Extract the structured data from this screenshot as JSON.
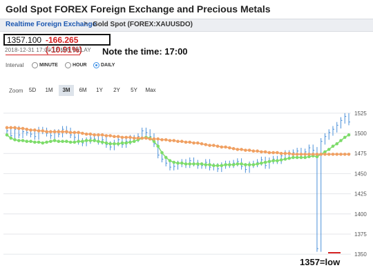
{
  "header": {
    "title": "Gold Spot FOREX Foreign Exchange and Precious Metals"
  },
  "breadcrumb": {
    "link": "Realtime Foreign Exchange",
    "separator": ">",
    "current": "Gold Spot (FOREX:XAUUSDO)"
  },
  "quote": {
    "price": "1357.100",
    "change": "-166.265 (-10.91%)",
    "timestamp": "2018-12-31 17:00:12",
    "delay": "MIN DELAY"
  },
  "annotations": {
    "time_note": "Note the time: 17:00",
    "low_note": "1357=low"
  },
  "interval": {
    "label": "Interval",
    "options": [
      "MINUTE",
      "HOUR",
      "DAILY"
    ],
    "selected": "DAILY"
  },
  "zoom": {
    "label": "Zoom",
    "options": [
      "5D",
      "1M",
      "3M",
      "6M",
      "1Y",
      "2Y",
      "5Y",
      "Max"
    ],
    "selected": "3M"
  },
  "colors": {
    "price_bars": "#4a90d9",
    "ma_short": "#7ddc6a",
    "ma_long": "#f0a062",
    "change_red": "#d42020",
    "link_blue": "#1a56b0"
  },
  "chart_data": {
    "type": "line",
    "ylim": [
      1345,
      1530
    ],
    "yticks": [
      "1525",
      "1500",
      "1475",
      "1450",
      "1425",
      "1400",
      "1375",
      "1350"
    ],
    "series": [
      {
        "values": [
          1503,
          1497,
          1505,
          1498,
          1502,
          1501,
          1499,
          1496,
          1504,
          1503,
          1500,
          1497,
          1501,
          1499,
          1505,
          1503,
          1498,
          1495,
          1490,
          1488,
          1491,
          1494,
          1493,
          1490,
          1492,
          1486,
          1483,
          1488,
          1492,
          1486,
          1490,
          1494,
          1493,
          1496,
          1503,
          1501,
          1496,
          1487,
          1473,
          1468,
          1463,
          1458,
          1459,
          1462,
          1464,
          1461,
          1466,
          1463,
          1460,
          1460,
          1464,
          1458,
          1459,
          1456,
          1460,
          1462,
          1461,
          1463,
          1465,
          1459,
          1455,
          1461,
          1462,
          1464,
          1467,
          1460,
          1466,
          1468,
          1466,
          1472,
          1475,
          1474,
          1476,
          1478,
          1474,
          1477,
          1482,
          1479,
          1357,
          1490,
          1496,
          1501,
          1505,
          1510,
          1516,
          1521,
          1514
        ]
      },
      {
        "values": [
          1498,
          1494,
          1492,
          1491,
          1491,
          1490,
          1490,
          1489,
          1489,
          1488,
          1489,
          1490,
          1491,
          1490,
          1490,
          1490,
          1489,
          1489,
          1490,
          1490,
          1491,
          1491,
          1491,
          1490,
          1489,
          1488,
          1487,
          1487,
          1487,
          1488,
          1488,
          1489,
          1490,
          1492,
          1494,
          1495,
          1494,
          1490,
          1484,
          1476,
          1470,
          1466,
          1464,
          1463,
          1463,
          1462,
          1462,
          1462,
          1462,
          1462,
          1461,
          1461,
          1460,
          1460,
          1460,
          1461,
          1461,
          1461,
          1462,
          1462,
          1461,
          1461,
          1461,
          1462,
          1463,
          1464,
          1465,
          1466,
          1466,
          1467,
          1468,
          1469,
          1470,
          1470,
          1470,
          1470,
          1471,
          1472,
          1471,
          1474,
          1477,
          1480,
          1484,
          1487,
          1491,
          1495,
          1498
        ]
      },
      {
        "values": [
          1507,
          1507,
          1507,
          1506,
          1506,
          1505,
          1504,
          1504,
          1503,
          1503,
          1502,
          1502,
          1502,
          1502,
          1502,
          1502,
          1501,
          1501,
          1501,
          1500,
          1499,
          1499,
          1498,
          1498,
          1498,
          1497,
          1497,
          1496,
          1496,
          1495,
          1495,
          1495,
          1494,
          1494,
          1494,
          1494,
          1493,
          1493,
          1493,
          1492,
          1492,
          1491,
          1491,
          1490,
          1490,
          1489,
          1489,
          1488,
          1488,
          1487,
          1486,
          1485,
          1485,
          1484,
          1483,
          1483,
          1482,
          1481,
          1480,
          1480,
          1479,
          1479,
          1478,
          1478,
          1477,
          1477,
          1476,
          1476,
          1476,
          1475,
          1475,
          1475,
          1474,
          1474,
          1474,
          1474,
          1474,
          1474,
          1474,
          1474,
          1474,
          1474,
          1474,
          1474,
          1474,
          1474,
          1474
        ]
      }
    ]
  }
}
